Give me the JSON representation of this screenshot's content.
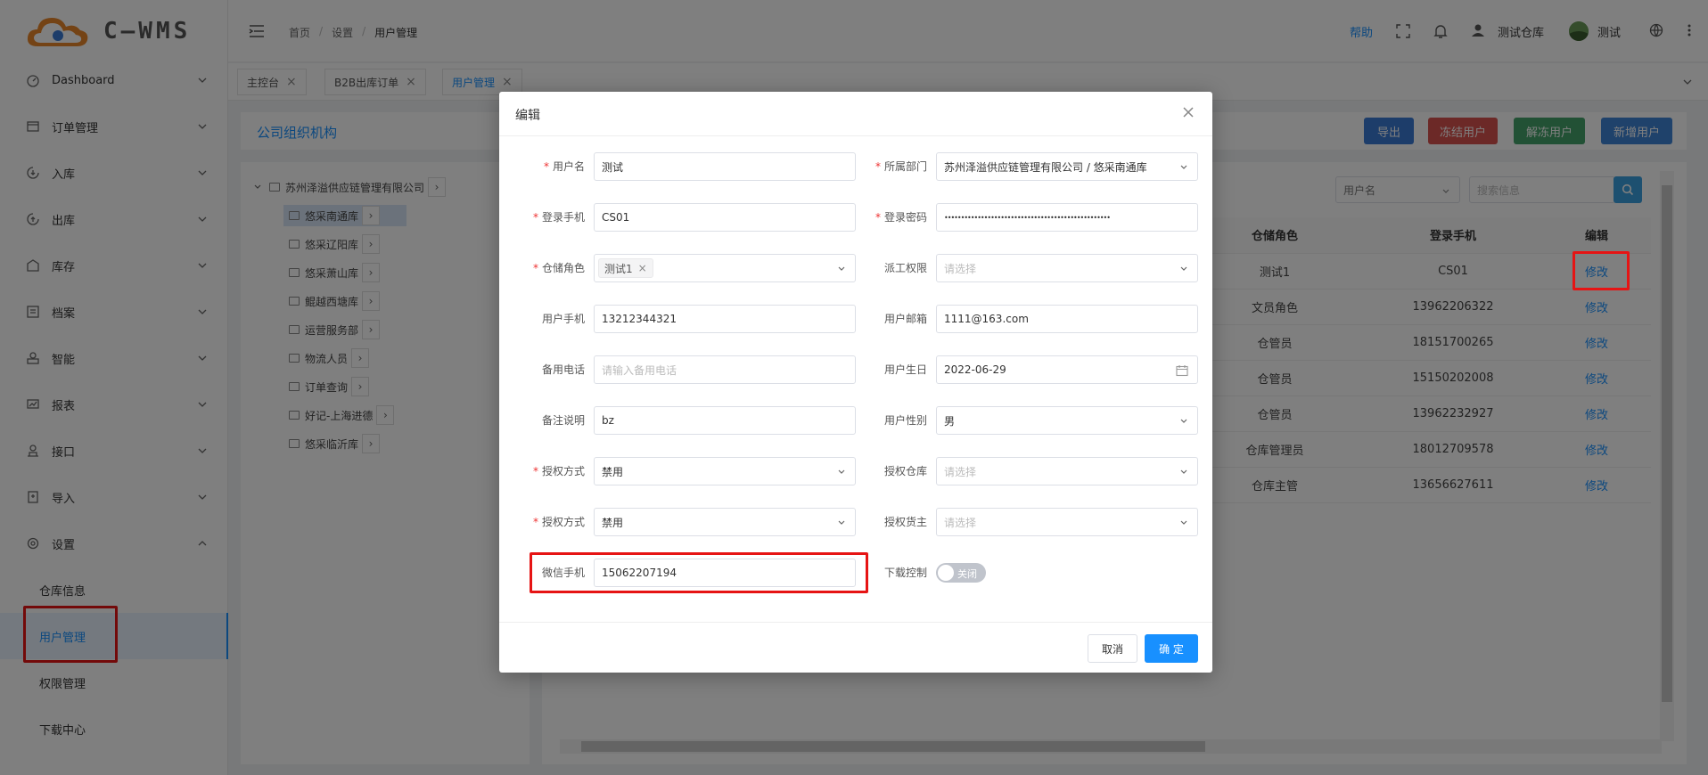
{
  "app": {
    "brand": "C—WMS"
  },
  "header": {
    "breadcrumb": [
      "首页",
      "设置",
      "用户管理"
    ],
    "help": "帮助",
    "warehouse": "测试仓库",
    "user": "测试"
  },
  "sidebar": {
    "items": [
      {
        "label": "Dashboard",
        "icon": "dashboard-icon"
      },
      {
        "label": "订单管理",
        "icon": "order-icon"
      },
      {
        "label": "入库",
        "icon": "inbound-icon"
      },
      {
        "label": "出库",
        "icon": "outbound-icon"
      },
      {
        "label": "库存",
        "icon": "inventory-icon"
      },
      {
        "label": "档案",
        "icon": "archive-icon"
      },
      {
        "label": "智能",
        "icon": "smart-icon"
      },
      {
        "label": "报表",
        "icon": "report-icon"
      },
      {
        "label": "接口",
        "icon": "interface-icon"
      },
      {
        "label": "导入",
        "icon": "import-icon"
      },
      {
        "label": "设置",
        "icon": "settings-icon"
      }
    ],
    "sub_items": [
      "仓库信息",
      "用户管理",
      "权限管理",
      "下载中心"
    ]
  },
  "tabs": [
    "主控台",
    "B2B出库订单",
    "用户管理"
  ],
  "page": {
    "title": "公司组织机构",
    "buttons": {
      "export": "导出",
      "freeze": "冻结用户",
      "unfreeze": "解冻用户",
      "add": "新增用户"
    },
    "search_select": "用户名",
    "search_placeholder": "搜索信息"
  },
  "tree": {
    "root": "苏州泽溢供应链管理有限公司",
    "children": [
      "悠采南通库",
      "悠采辽阳库",
      "悠采萧山库",
      "鲲越西塘库",
      "运营服务部",
      "物流人员",
      "订单查询",
      "好记-上海进德",
      "悠采临沂库"
    ]
  },
  "table": {
    "headers": [
      "仓储角色",
      "登录手机",
      "编辑"
    ],
    "rows": [
      {
        "role": "测试1",
        "phone": "CS01",
        "action": "修改"
      },
      {
        "role": "文员角色",
        "phone": "13962206322",
        "action": "修改"
      },
      {
        "role": "仓管员",
        "phone": "18151700265",
        "action": "修改"
      },
      {
        "role": "仓管员",
        "phone": "15150202008",
        "action": "修改"
      },
      {
        "role": "仓管员",
        "phone": "13962232927",
        "action": "修改"
      },
      {
        "role": "仓库管理员",
        "phone": "18012709578",
        "action": "修改"
      },
      {
        "role": "仓库主管",
        "phone": "13656627611",
        "action": "修改"
      }
    ]
  },
  "modal": {
    "title": "编辑",
    "fields": {
      "username": {
        "label": "用户名",
        "value": "测试"
      },
      "department": {
        "label": "所属部门",
        "value": "苏州泽溢供应链管理有限公司 / 悠采南通库"
      },
      "login_phone": {
        "label": "登录手机",
        "value": "CS01"
      },
      "password": {
        "label": "登录密码",
        "value": "••••••••••••••••••••••••••••••••••••••••••••••••••"
      },
      "role": {
        "label": "仓储角色",
        "tag": "测试1"
      },
      "dispatch": {
        "label": "派工权限",
        "placeholder": "请选择"
      },
      "user_phone": {
        "label": "用户手机",
        "value": "13212344321"
      },
      "email": {
        "label": "用户邮箱",
        "value": "1111@163.com"
      },
      "backup_phone": {
        "label": "备用电话",
        "placeholder": "请输入备用电话"
      },
      "birthday": {
        "label": "用户生日",
        "value": "2022-06-29"
      },
      "remark": {
        "label": "备注说明",
        "value": "bz"
      },
      "gender": {
        "label": "用户性别",
        "value": "男"
      },
      "auth_mode_1": {
        "label": "授权方式",
        "value": "禁用"
      },
      "auth_warehouse": {
        "label": "授权仓库",
        "placeholder": "请选择"
      },
      "auth_mode_2": {
        "label": "授权方式",
        "value": "禁用"
      },
      "auth_owner": {
        "label": "授权货主",
        "placeholder": "请选择"
      },
      "wechat_phone": {
        "label": "微信手机",
        "value": "15062207194"
      },
      "download_control": {
        "label": "下载控制",
        "toggle": "关闭"
      }
    },
    "cancel": "取消",
    "ok": "确 定"
  },
  "colors": {
    "primary": "#1890ff",
    "highlight": "#e61414",
    "export": "#3a7bd5",
    "freeze": "#d9534f",
    "unfreeze": "#45a36a",
    "add": "#3f85d6"
  }
}
